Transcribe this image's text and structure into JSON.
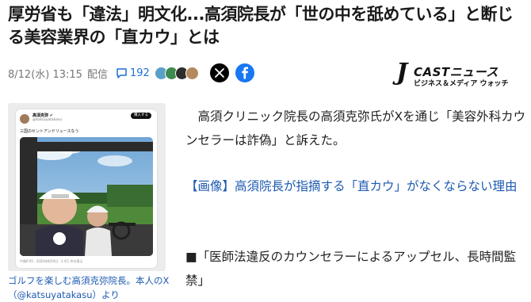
{
  "article": {
    "headline": "厚労省も「違法」明文化...高須院長が「世の中を舐めている」と断じる美容業界の「直カウ」とは",
    "date": "8/12(水) 13:15",
    "date_suffix": "配信",
    "comment_count": "192",
    "paragraph1": "　高須クリニック院長の高須克弥氏がXを通じ「美容外科カウンセラーは詐偽」と訴えた。",
    "paragraph2_link": "【画像】高須院長が指摘する「直カウ」がなくならない理由",
    "paragraph3": "■「医師法違反のカウンセラーによるアップセル、長時間監禁」"
  },
  "share": {
    "x_icon": "x-logo-icon",
    "facebook_icon": "facebook-logo-icon"
  },
  "publisher": {
    "logo_main": "CASTニュース",
    "logo_j": "J",
    "logo_sub": "ビジネス＆メディア ウォッチ"
  },
  "photo": {
    "tweet_name": "高須克弥 ✔",
    "tweet_handle": "@katsuyatakasu",
    "tweet_follow": "購入する",
    "tweet_text": "三国のセントアンドリュースなう",
    "tweet_footer": "午後6:05 · 2020年8月9日 · 3.4万 件の表示",
    "caption": "ゴルフを楽しむ高須克弥院長。本人のX（@katsuyatakasu）より"
  },
  "colors": {
    "link_blue": "#1d5ab0",
    "facebook_blue": "#1877f2",
    "x_black": "#000000"
  }
}
